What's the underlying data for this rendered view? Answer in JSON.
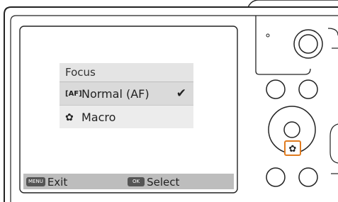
{
  "menu": {
    "title": "Focus",
    "items": [
      {
        "icon": "[AF]",
        "label": "Normal (AF)",
        "checked": true,
        "mark": "✔"
      },
      {
        "icon": "✿",
        "label": "Macro",
        "checked": false
      }
    ]
  },
  "bottom_bar": {
    "exit_key": "MENU",
    "exit_label": "Exit",
    "select_key": "OK",
    "select_label": "Select"
  },
  "camera": {
    "macro_button_icon": "✿",
    "highlight_color": "#e07b1f"
  }
}
